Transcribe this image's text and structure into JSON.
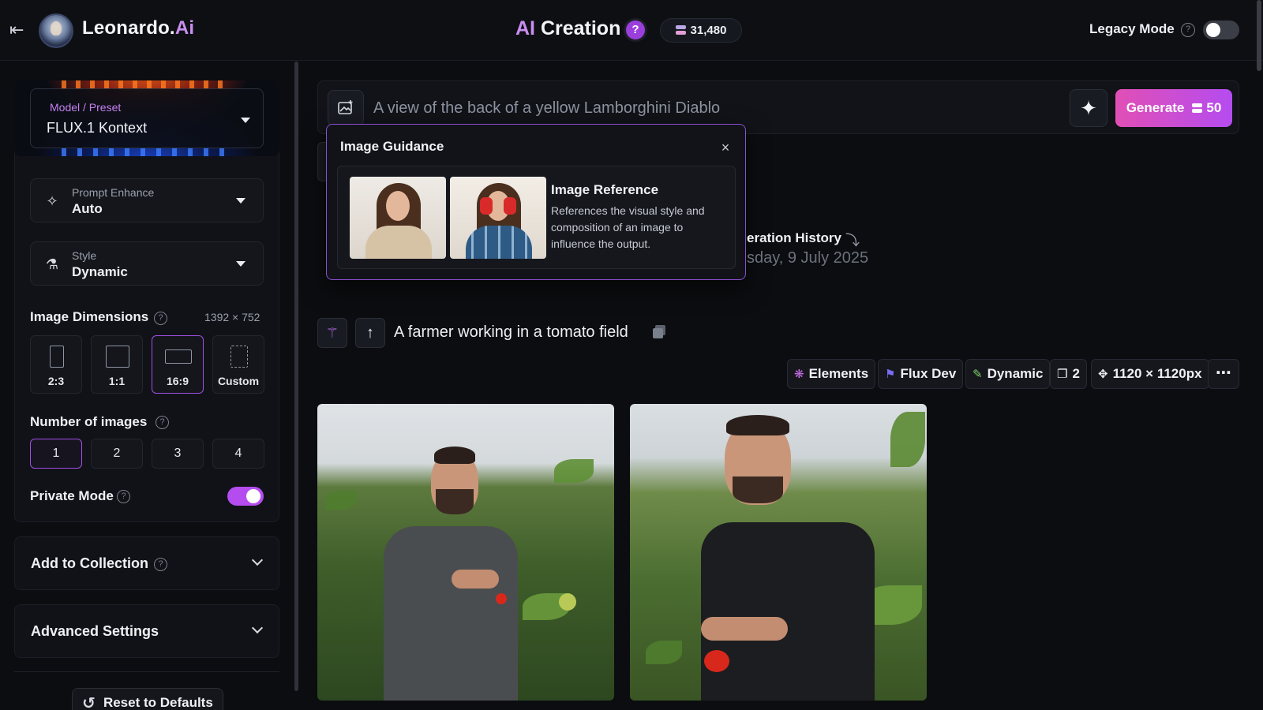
{
  "header": {
    "brand_name": "Leonardo.",
    "brand_suffix": "Ai",
    "title_ai": "AI",
    "title_rest": " Creation",
    "help_glyph": "?",
    "credits": "31,480",
    "legacy_mode_label": "Legacy Mode",
    "legacy_mode_on": false
  },
  "sidebar": {
    "model_kicker": "Model / Preset",
    "model_value": "FLUX.1 Kontext",
    "prompt_enhance_kicker": "Prompt Enhance",
    "prompt_enhance_value": "Auto",
    "style_kicker": "Style",
    "style_value": "Dynamic",
    "dimensions_label": "Image Dimensions",
    "dimensions_value": "1392 × 752",
    "dimension_options": [
      {
        "label": "2:3"
      },
      {
        "label": "1:1"
      },
      {
        "label": "16:9",
        "selected": true
      },
      {
        "label": "Custom"
      }
    ],
    "num_images_label": "Number of images",
    "num_images_options": [
      "1",
      "2",
      "3",
      "4"
    ],
    "num_images_selected": "1",
    "private_mode_label": "Private Mode",
    "private_mode_on": true,
    "add_collection_label": "Add to Collection",
    "advanced_settings_label": "Advanced Settings",
    "reset_label": "Reset to Defaults"
  },
  "prompt": {
    "placeholder": "A view of the back of a yellow Lamborghini Diablo",
    "generate_label": "Generate",
    "generate_cost": "50"
  },
  "image_guidance": {
    "title": "Image Guidance",
    "card_title": "Image Reference",
    "card_description": "References the visual style and composition of an image to influence the output."
  },
  "history": {
    "title_partial": "eration History",
    "date_partial": "sday, 9 July 2025"
  },
  "generation": {
    "prompt": "A farmer working in a tomato field",
    "tags": [
      {
        "icon": "elements-icon",
        "label": "Elements"
      },
      {
        "icon": "flux-icon",
        "label": "Flux Dev"
      },
      {
        "icon": "brush-icon",
        "label": "Dynamic"
      },
      {
        "icon": "images-icon",
        "label": "2"
      },
      {
        "icon": "resize-icon",
        "label": "1120 × 1120px"
      }
    ]
  },
  "colors": {
    "accent_purple": "#b54cf0",
    "accent_pink": "#e14fb5",
    "background": "#0b0d10"
  }
}
